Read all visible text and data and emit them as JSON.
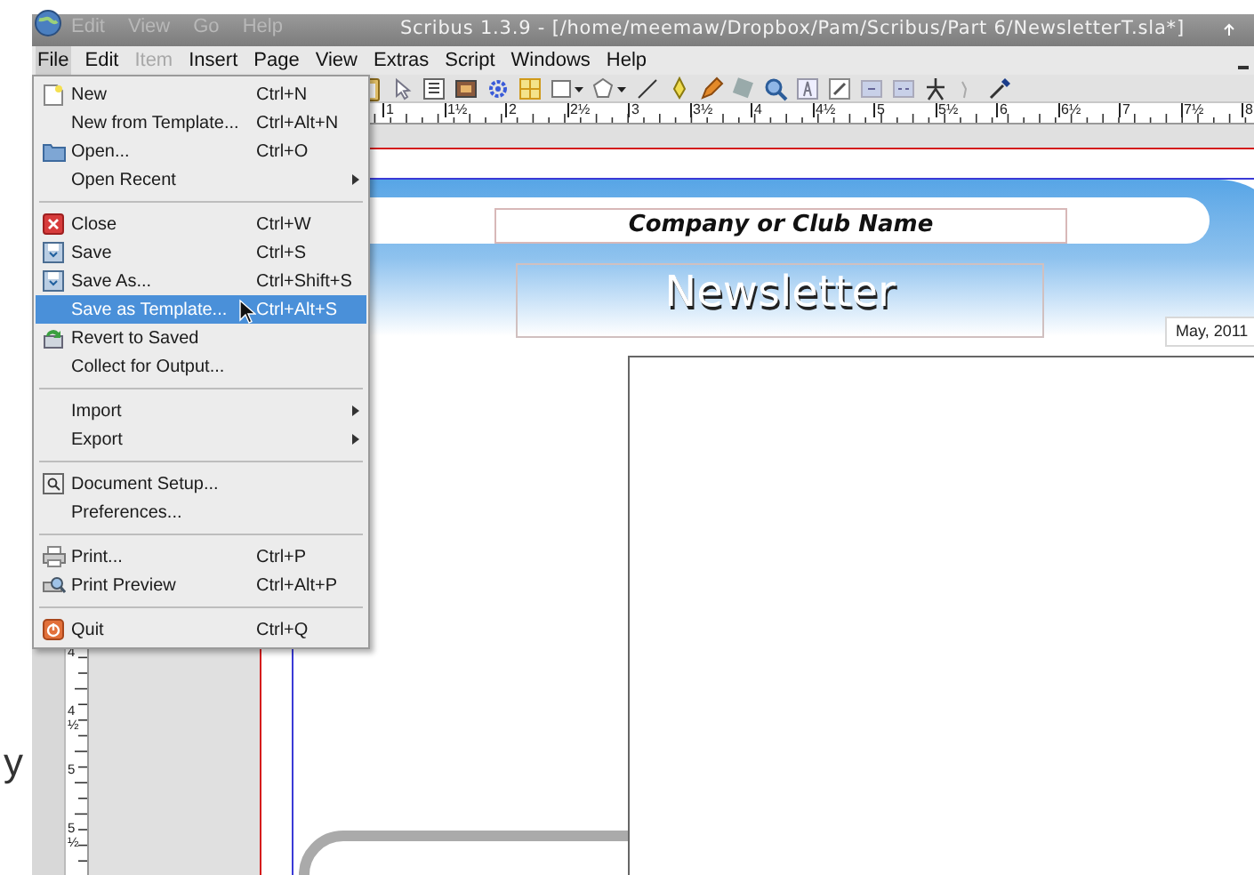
{
  "background_window": {
    "menu": [
      "Edit",
      "View",
      "Go",
      "Help"
    ]
  },
  "window": {
    "title": "Scribus 1.3.9 - [/home/meemaw/Dropbox/Pam/Scribus/Part 6/NewsletterT.sla*]"
  },
  "menu_bar": [
    {
      "label": "File",
      "selected": true,
      "disabled": false
    },
    {
      "label": "Edit",
      "selected": false,
      "disabled": false
    },
    {
      "label": "Item",
      "selected": false,
      "disabled": true
    },
    {
      "label": "Insert",
      "selected": false,
      "disabled": false
    },
    {
      "label": "Page",
      "selected": false,
      "disabled": false
    },
    {
      "label": "View",
      "selected": false,
      "disabled": false
    },
    {
      "label": "Extras",
      "selected": false,
      "disabled": false
    },
    {
      "label": "Script",
      "selected": false,
      "disabled": false
    },
    {
      "label": "Windows",
      "selected": false,
      "disabled": false
    },
    {
      "label": "Help",
      "selected": false,
      "disabled": false
    }
  ],
  "file_menu": [
    {
      "kind": "item",
      "label": "New",
      "shortcut": "Ctrl+N",
      "submenu": false,
      "selected": false
    },
    {
      "kind": "item",
      "label": "New from Template...",
      "shortcut": "Ctrl+Alt+N",
      "submenu": false,
      "selected": false
    },
    {
      "kind": "item",
      "label": "Open...",
      "shortcut": "Ctrl+O",
      "submenu": false,
      "selected": false
    },
    {
      "kind": "item",
      "label": "Open Recent",
      "submenu": true,
      "selected": false
    },
    {
      "kind": "separator"
    },
    {
      "kind": "item",
      "label": "Close",
      "shortcut": "Ctrl+W",
      "submenu": false,
      "selected": false
    },
    {
      "kind": "item",
      "label": "Save",
      "shortcut": "Ctrl+S",
      "submenu": false,
      "selected": false
    },
    {
      "kind": "item",
      "label": "Save As...",
      "shortcut": "Ctrl+Shift+S",
      "submenu": false,
      "selected": false
    },
    {
      "kind": "item",
      "label": "Save as Template...",
      "shortcut": "Ctrl+Alt+S",
      "submenu": false,
      "selected": true
    },
    {
      "kind": "item",
      "label": "Revert to Saved",
      "submenu": false,
      "selected": false
    },
    {
      "kind": "item",
      "label": "Collect for Output...",
      "submenu": false,
      "selected": false
    },
    {
      "kind": "separator"
    },
    {
      "kind": "item",
      "label": "Import",
      "submenu": true,
      "selected": false
    },
    {
      "kind": "item",
      "label": "Export",
      "submenu": true,
      "selected": false
    },
    {
      "kind": "separator"
    },
    {
      "kind": "item",
      "label": "Document Setup...",
      "submenu": false,
      "selected": false
    },
    {
      "kind": "item",
      "label": "Preferences...",
      "submenu": false,
      "selected": false
    },
    {
      "kind": "separator"
    },
    {
      "kind": "item",
      "label": "Print...",
      "shortcut": "Ctrl+P",
      "submenu": false,
      "selected": false
    },
    {
      "kind": "item",
      "label": "Print Preview",
      "shortcut": "Ctrl+Alt+P",
      "submenu": false,
      "selected": false
    },
    {
      "kind": "separator"
    },
    {
      "kind": "item",
      "label": "Quit",
      "shortcut": "Ctrl+Q",
      "submenu": false,
      "selected": false
    }
  ],
  "horizontal_ruler": [
    "1",
    "1½",
    "2",
    "2½",
    "3",
    "3½",
    "4",
    "4½",
    "5",
    "5½",
    "6",
    "6½",
    "7",
    "7½",
    "8"
  ],
  "vertical_ruler": [
    "4",
    "4½",
    "5",
    "5½"
  ],
  "page": {
    "company_name": "Company or Club Name",
    "title": "Newsletter",
    "date": "May, 2011"
  },
  "stray_text": "y"
}
